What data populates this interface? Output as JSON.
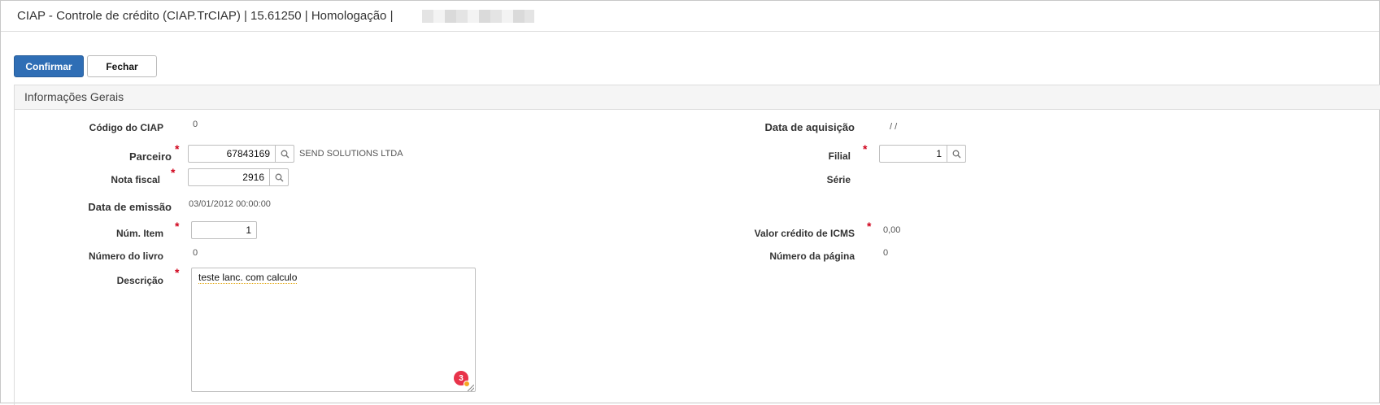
{
  "window": {
    "title": "CIAP - Controle de crédito (CIAP.TrCIAP) | 15.61250 | Homologação |"
  },
  "toolbar": {
    "confirm_label": "Confirmar",
    "close_label": "Fechar"
  },
  "panel": {
    "title": "Informações Gerais"
  },
  "form": {
    "codigo_ciap": {
      "label": "Código do CIAP",
      "value": "0"
    },
    "data_aquisicao": {
      "label": "Data de aquisição",
      "value": "/ /"
    },
    "parceiro": {
      "label": "Parceiro",
      "value": "67843169",
      "description": "SEND SOLUTIONS LTDA"
    },
    "filial": {
      "label": "Filial",
      "value": "1"
    },
    "nota_fiscal": {
      "label": "Nota fiscal",
      "value": "2916"
    },
    "serie": {
      "label": "Série"
    },
    "data_emissao": {
      "label": "Data de emissão",
      "value": "03/01/2012 00:00:00"
    },
    "num_item": {
      "label": "Núm. Item",
      "value": "1"
    },
    "valor_credito_icms": {
      "label": "Valor crédito de ICMS",
      "value": "0,00"
    },
    "numero_livro": {
      "label": "Número do livro",
      "value": "0"
    },
    "numero_pagina": {
      "label": "Número da página",
      "value": "0"
    },
    "descricao": {
      "label": "Descrição",
      "value": "teste lanc. com calculo"
    },
    "required_mark": "*"
  },
  "spellcheck": {
    "count": "3"
  },
  "icons": {
    "lookup": "search-icon",
    "spellcheck": "grammar-badge-icon",
    "resize": "resize-grip-icon"
  },
  "colors": {
    "primary": "#2f6eb5",
    "required": "#d0021b",
    "badge": "#e8334a"
  }
}
